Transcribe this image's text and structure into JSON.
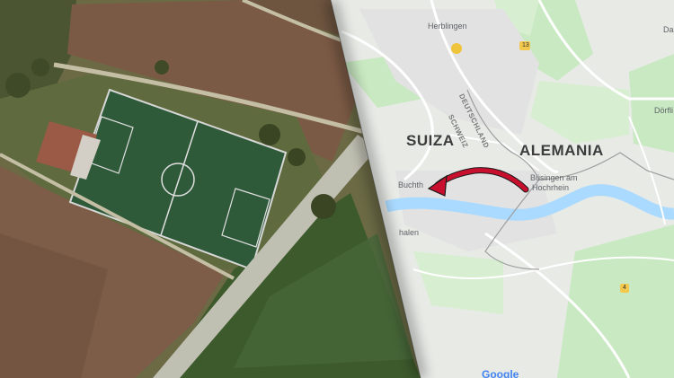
{
  "satellite_view": {
    "description": "aerial-photo"
  },
  "map_view": {
    "countries": {
      "left": "SUIZA",
      "right": "ALEMANIA"
    },
    "places": {
      "herblingen": "Herblingen",
      "buchthalen": "Buchth",
      "busingen_line1": "Büsingen am",
      "busingen_line2": "Hochrhein",
      "dorflingen": "Dörfli",
      "thayngen_partial": "Da",
      "feuerthalen_partial": "halen"
    },
    "border_labels": {
      "deutschland": "DEUTSCHLAND",
      "schweiz": "SCHWEIZ"
    },
    "route_markers": [
      "13",
      "4"
    ],
    "watermark": "Google"
  },
  "colors": {
    "arrow": "#c8102e",
    "river": "#aadaff",
    "land": "#e8eae6",
    "green": "#c9e9c2",
    "field_green": "#3d5a2c"
  }
}
